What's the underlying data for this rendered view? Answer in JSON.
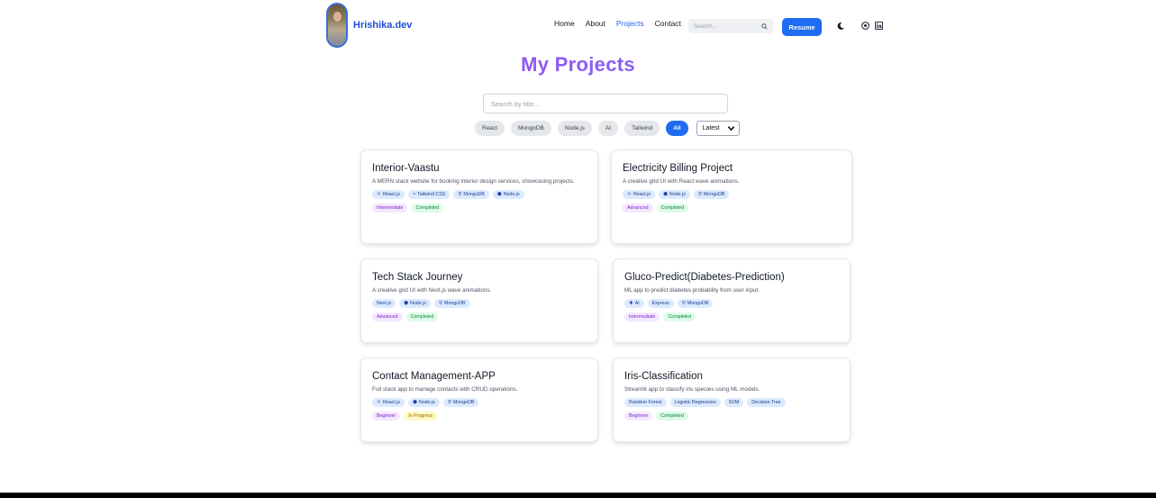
{
  "brand": {
    "name": "Hrishika.dev"
  },
  "nav": {
    "links": [
      "Home",
      "About",
      "Projects",
      "Contact"
    ],
    "search_placeholder": "Search...",
    "resume_label": "Resume"
  },
  "page_title": "My Projects",
  "search": {
    "placeholder": "Search by title..."
  },
  "filters": {
    "chips": [
      "React",
      "MongoDB",
      "Node.js",
      "AI",
      "Tailwind",
      "All"
    ],
    "active": "All",
    "sort_selected": "Latest"
  },
  "projects": [
    {
      "title": "Interior-Vaastu",
      "description": "A MERN stack website for booking interior design services, showcasing projects.",
      "tags": [
        {
          "icon": "react-icon",
          "glyph": "⚛",
          "label": "React.js"
        },
        {
          "icon": "tailwind-icon",
          "glyph": "≈",
          "label": "Tailwind CSS"
        },
        {
          "icon": "mongodb-icon",
          "glyph": "⚲",
          "label": "MongoDB"
        },
        {
          "icon": "nodejs-icon",
          "glyph": "⬢",
          "label": "Node.js"
        }
      ],
      "level": "Intermediate",
      "status": "Completed"
    },
    {
      "title": "Electricity Billing Project",
      "description": "A creative grid UI with React wave animations.",
      "tags": [
        {
          "icon": "react-icon",
          "glyph": "⚛",
          "label": "React.js"
        },
        {
          "icon": "nodejs-icon",
          "glyph": "⬢",
          "label": "Node.js"
        },
        {
          "icon": "mongodb-icon",
          "glyph": "⚲",
          "label": "MongoDB"
        }
      ],
      "level": "Advanced",
      "status": "Completed"
    },
    {
      "title": "Tech Stack Journey",
      "description": "A creative grid UI with Next.js wave animations.",
      "tags": [
        {
          "icon": "",
          "glyph": "",
          "label": "Next.js"
        },
        {
          "icon": "nodejs-icon",
          "glyph": "⬢",
          "label": "Node.js"
        },
        {
          "icon": "mongodb-icon",
          "glyph": "⚲",
          "label": "MongoDB"
        }
      ],
      "level": "Advanced",
      "status": "Completed"
    },
    {
      "title": "Gluco-Predict(Diabetes-Prediction)",
      "description": "ML app to predict diabetes probability from user input.",
      "tags": [
        {
          "icon": "ai-icon",
          "glyph": "✚",
          "label": "AI"
        },
        {
          "icon": "",
          "glyph": "",
          "label": "Express"
        },
        {
          "icon": "mongodb-icon",
          "glyph": "⚲",
          "label": "MongoDB"
        }
      ],
      "level": "Intermediate",
      "status": "Completed"
    },
    {
      "title": "Contact Management-APP",
      "description": "Full stack app to manage contacts with CRUD operations.",
      "tags": [
        {
          "icon": "react-icon",
          "glyph": "⚛",
          "label": "React.js"
        },
        {
          "icon": "nodejs-icon",
          "glyph": "⬢",
          "label": "Node.js"
        },
        {
          "icon": "mongodb-icon",
          "glyph": "⚲",
          "label": "MongoDB"
        }
      ],
      "level": "Beginner",
      "status": "In Progress"
    },
    {
      "title": "Iris-Classification",
      "description": "Streamlit app to classify iris species using ML models.",
      "tags": [
        {
          "icon": "",
          "glyph": "",
          "label": "Random Forest"
        },
        {
          "icon": "",
          "glyph": "",
          "label": "Logistic Regression"
        },
        {
          "icon": "",
          "glyph": "",
          "label": "SVM"
        },
        {
          "icon": "",
          "glyph": "",
          "label": "Decision Tree"
        }
      ],
      "level": "Beginner",
      "status": "Completed"
    }
  ]
}
